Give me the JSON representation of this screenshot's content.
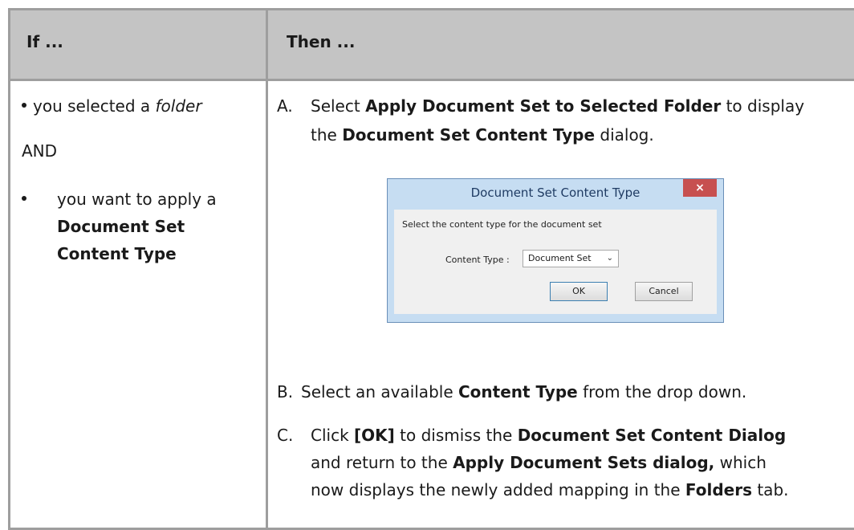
{
  "header": {
    "if_label": "If ...",
    "then_label": "Then ..."
  },
  "left_column": {
    "item1_prefix": "you selected a ",
    "item1_em": "folder",
    "and_label": "AND",
    "item2_line1": "you want to apply a",
    "item2_bold_line2": "Document Set",
    "item2_bold_line3": "Content Type"
  },
  "steps": {
    "a": {
      "letter": "A.",
      "pre": "Select ",
      "bold1": "Apply Document Set to Selected Folder",
      "mid": " to display",
      "line2_pre": "the ",
      "bold2": "Document Set Content Type",
      "line2_post": " dialog."
    },
    "b": {
      "letter": "B.",
      "pre": "Select an available ",
      "bold1": "Content Type",
      "post": " from the drop down."
    },
    "c": {
      "letter": "C.",
      "pre": "Click ",
      "bold1": "[OK]",
      "mid": " to dismiss the ",
      "bold2": "Document Set Content Dialog",
      "line2_pre": "and return to the ",
      "bold3": "Apply Document Sets dialog,",
      "line2_post": " which",
      "line3_pre": "now displays the newly added mapping in the ",
      "bold4": "Folders",
      "line3_post": " tab."
    }
  },
  "dialog": {
    "title": "Document Set Content Type",
    "close_glyph": "×",
    "prompt": "Select the content type for the document set",
    "field_label": "Content Type :",
    "select_value": "Document Set",
    "chevron": "⌄",
    "ok_label": "OK",
    "cancel_label": "Cancel"
  }
}
